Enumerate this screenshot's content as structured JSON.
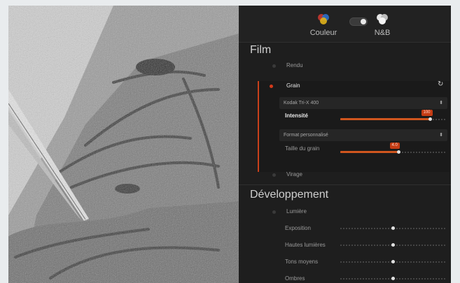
{
  "mode_bar": {
    "couleur_label": "Couleur",
    "nb_label": "N&B",
    "toggle_state": "N&B"
  },
  "film": {
    "title": "Film",
    "rendu_label": "Rendu",
    "grain": {
      "label": "Grain",
      "preset_value": "Kodak Tri-X 400",
      "intensite_label": "Intensité",
      "intensite_value": "100",
      "intensite_fraction": 0.85,
      "format_value": "Format personnalisé",
      "taille_label": "Taille du grain",
      "taille_value": "4.0",
      "taille_fraction": 0.55
    },
    "virage_label": "Virage"
  },
  "developpement": {
    "title": "Développement",
    "lumiere_label": "Lumière",
    "sliders": [
      {
        "label": "Exposition",
        "fraction": 0.5
      },
      {
        "label": "Hautes lumières",
        "fraction": 0.5
      },
      {
        "label": "Tons moyens",
        "fraction": 0.5
      },
      {
        "label": "Ombres",
        "fraction": 0.5
      }
    ]
  },
  "colors": {
    "accent": "#d0561e",
    "panel_bg": "#1e1e1e",
    "active_dot": "#d43a1a"
  }
}
